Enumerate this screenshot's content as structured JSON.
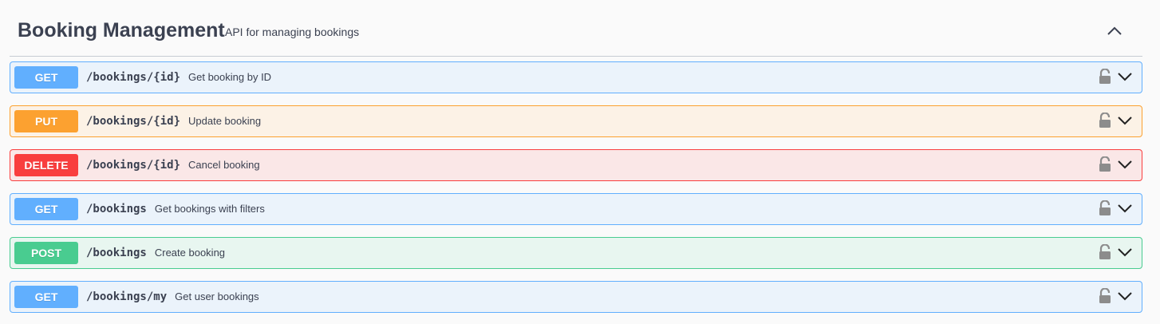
{
  "tag": {
    "title": "Booking Management",
    "description": "API for managing bookings",
    "toggle_icon": "chevron-up-icon"
  },
  "colors": {
    "get": "#61affe",
    "put": "#fca130",
    "delete": "#f93e3e",
    "post": "#49cc90"
  },
  "operations": [
    {
      "method": "GET",
      "path": "/bookings/{id}",
      "summary": "Get booking by ID"
    },
    {
      "method": "PUT",
      "path": "/bookings/{id}",
      "summary": "Update booking"
    },
    {
      "method": "DELETE",
      "path": "/bookings/{id}",
      "summary": "Cancel booking"
    },
    {
      "method": "GET",
      "path": "/bookings",
      "summary": "Get bookings with filters"
    },
    {
      "method": "POST",
      "path": "/bookings",
      "summary": "Create booking"
    },
    {
      "method": "GET",
      "path": "/bookings/my",
      "summary": "Get user bookings"
    }
  ]
}
